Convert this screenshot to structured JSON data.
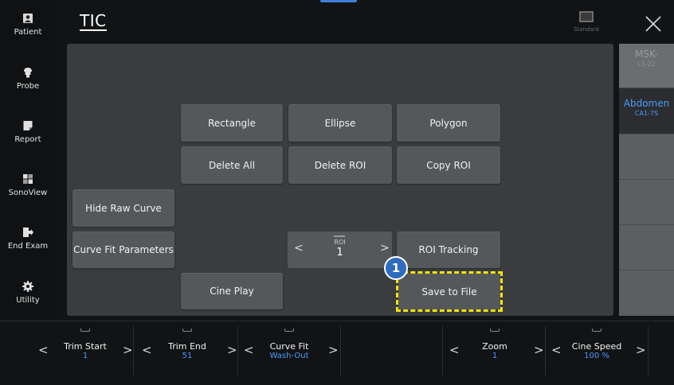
{
  "app": {
    "title": "TIC"
  },
  "header": {
    "preset_label": "Standard"
  },
  "sidebar": {
    "items": [
      {
        "label": "Patient",
        "icon": "patient-icon"
      },
      {
        "label": "Probe",
        "icon": "probe-icon"
      },
      {
        "label": "Report",
        "icon": "report-icon"
      },
      {
        "label": "SonoView",
        "icon": "sonoview-icon"
      },
      {
        "label": "End Exam",
        "icon": "end-exam-icon"
      },
      {
        "label": "Utility",
        "icon": "gear-icon"
      }
    ]
  },
  "panel": {
    "rectangle": "Rectangle",
    "ellipse": "Ellipse",
    "polygon": "Polygon",
    "delete_all": "Delete All",
    "delete_roi": "Delete ROI",
    "copy_roi": "Copy ROI",
    "hide_raw_curve": "Hide Raw Curve",
    "curve_fit_parameters": "Curve Fit Parameters",
    "roi_selector": {
      "label": "ROI",
      "value": "1"
    },
    "roi_tracking": "ROI Tracking",
    "cine_play": "Cine Play",
    "save_to_file": "Save to File"
  },
  "annotation": {
    "marker": "1",
    "color": "#f2e500"
  },
  "probes": [
    {
      "name": "MSK-",
      "model": "L3-22",
      "active": false
    },
    {
      "name": "Abdomen",
      "model": "CA1-7S",
      "active": true
    }
  ],
  "bottom": {
    "trim_start": {
      "label": "Trim Start",
      "value": "1"
    },
    "trim_end": {
      "label": "Trim End",
      "value": "51"
    },
    "curve_fit": {
      "label": "Curve Fit",
      "value": "Wash-Out"
    },
    "zoom": {
      "label": "Zoom",
      "value": "1"
    },
    "cine_speed": {
      "label": "Cine Speed",
      "value": "100 %"
    }
  },
  "colors": {
    "accent": "#4b9bff",
    "panel": "#3a3c3f",
    "button": "#55585b"
  }
}
